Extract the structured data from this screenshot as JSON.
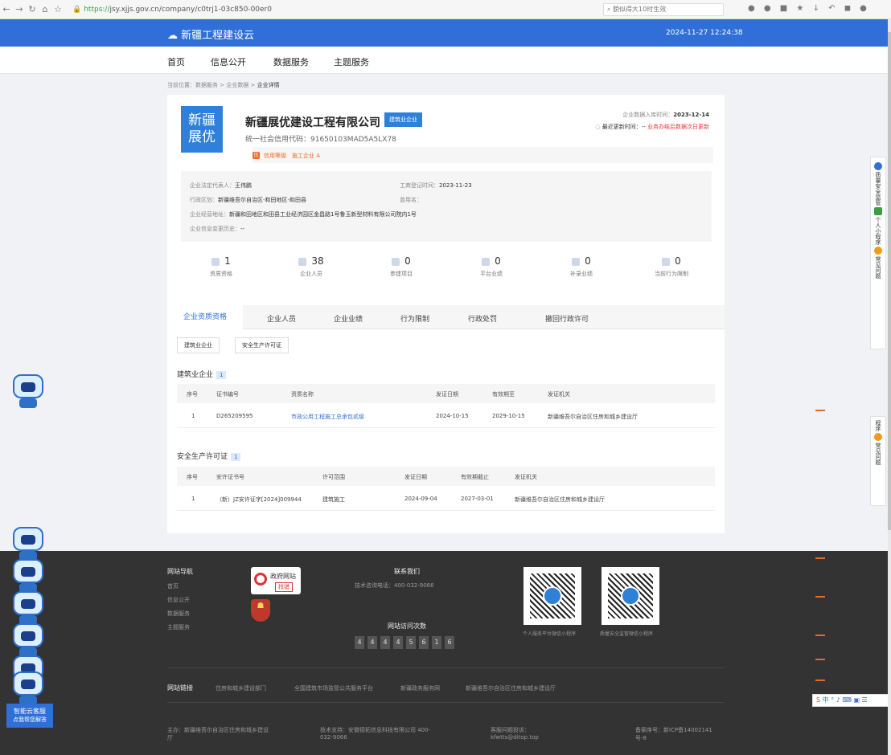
{
  "browser": {
    "url_prefix": "https://",
    "url": "jsy.xjjs.gov.cn/company/c0trj1-03c850-00er0",
    "search_placeholder": "貌似得大10时生效"
  },
  "header": {
    "site_name": "新疆工程建设云",
    "datetime": "2024-11-27 12:24:38"
  },
  "nav": {
    "items": [
      "首页",
      "信息公开",
      "数据服务",
      "主题服务"
    ]
  },
  "breadcrumb": {
    "prefix": "当前位置：数据服务 > 企业数据 > ",
    "current": "企业详情"
  },
  "company": {
    "logo_line1": "新疆",
    "logo_line2": "展优",
    "name": "新疆展优建设工程有限公司",
    "tag": "建筑业企业",
    "credit_code": "统一社会信用代码：91650103MAD5A5LX78",
    "rating_label": "信用等级",
    "rating_value": "施工企业 A",
    "store_label": "企业数据入库时间：",
    "store_date": "2023-12-14",
    "update_label": "最近更新时间：-- ",
    "update_note": "业务办结后数据次日更新"
  },
  "info": {
    "legal_label": "企业法定代表人：",
    "legal_value": "王伟鹏",
    "reg_label": "工商登记时间：",
    "reg_value": "2023-11-23",
    "region_label": "行政区划：",
    "region_value": "新疆维吾尔自治区-和田地区-和田县",
    "former_label": "曾用名：",
    "former_value": "",
    "address_label": "企业经营地址：",
    "address_value": "新疆和田地区和田县工业经济园区金昌路1号鲁玉新型材料有限公司院内1号",
    "history_label": "企业信息变更历史：",
    "history_value": "--"
  },
  "stats": [
    {
      "value": "1",
      "label": "资质资格"
    },
    {
      "value": "38",
      "label": "企业人员"
    },
    {
      "value": "0",
      "label": "参建项目"
    },
    {
      "value": "0",
      "label": "平台业绩"
    },
    {
      "value": "0",
      "label": "补录业绩"
    },
    {
      "value": "0",
      "label": "当前行为限制"
    }
  ],
  "tabs": [
    "企业资质资格",
    "企业人员",
    "企业业绩",
    "行为限制",
    "行政处罚",
    "撤回行政许可"
  ],
  "subtabs": [
    "建筑业企业",
    "安全生产许可证"
  ],
  "section1": {
    "title": "建筑业企业",
    "count": "1",
    "headers": [
      "序号",
      "证书编号",
      "资质名称",
      "发证日期",
      "有效期至",
      "发证机关"
    ],
    "rows": [
      [
        "1",
        "D265209595",
        "市政公用工程施工总承包贰级",
        "2024-10-15",
        "2029-10-15",
        "新疆维吾尔自治区住房和城乡建设厅"
      ]
    ]
  },
  "section2": {
    "title": "安全生产许可证",
    "count": "1",
    "headers": [
      "序号",
      "安许证书号",
      "许可范围",
      "发证日期",
      "有效期截止",
      "发证机关"
    ],
    "rows": [
      [
        "1",
        "（新）JZ安许证字[2024]009944",
        "建筑施工",
        "2024-09-04",
        "2027-03-01",
        "新疆维吾尔自治区住房和城乡建设厅"
      ]
    ]
  },
  "footer": {
    "nav_title": "网站导航",
    "nav_items": [
      "首页",
      "信息公开",
      "数据服务",
      "主题服务"
    ],
    "gov_badge_line1": "政府网站",
    "gov_badge_line2": "找错",
    "contact_title": "联系我们",
    "contact_phone": "技术咨询电话：400-032-9066",
    "visits_title": "网站访问次数",
    "visits_digits": [
      "4",
      "4",
      "4",
      "4",
      "5",
      "6",
      "1",
      "6"
    ],
    "qr1_label": "个人服务平台微信小程序",
    "qr2_label": "质量安全监管微信小程序",
    "links_title": "网站链接",
    "links": [
      "住房和城乡建设部门",
      "全国建筑市场监管公共服务平台",
      "新疆政务服务网",
      "新疆维吾尔自治区住房和城乡建设厅"
    ],
    "host": "主办：新疆维吾尔自治区住房和城乡建设厅",
    "support": "技术支持：安徽德拓信息科技有限公司 400-032-9066",
    "complaint": "客服问题投诉：kfwtts@ditop.top",
    "icp": "备案序号：新ICP备14002141号-8"
  },
  "side": {
    "agent_line1": "智能云客服",
    "agent_line2": "点我帮您解答",
    "float1": [
      "质量安全监管",
      "个人小程序",
      "常见问题"
    ],
    "float2": [
      "程序",
      "常见问题"
    ]
  }
}
